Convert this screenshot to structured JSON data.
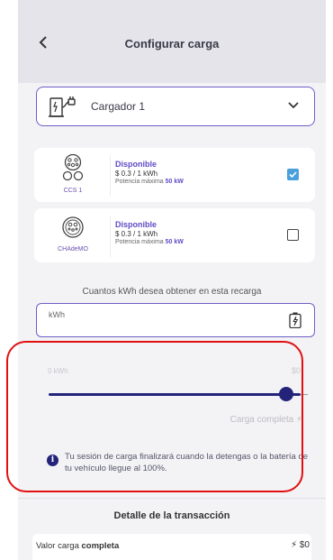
{
  "header": {
    "title": "Configurar carga"
  },
  "charger_select": {
    "selected": "Cargador 1"
  },
  "connectors": [
    {
      "name": "CCS 1",
      "status": "Disponible",
      "price": "$ 0.3 / 1 kWh",
      "power_label": "Potencia máxima",
      "power_value": "50 kW",
      "checked": true
    },
    {
      "name": "CHAdeMO",
      "status": "Disponible",
      "price": "$ 0.3 / 1 kWh",
      "power_label": "Potencia máxima",
      "power_value": "50 kW",
      "checked": false
    }
  ],
  "kwh_question": "Cuantos kWh desea obtener en esta recarga",
  "kwh_input": {
    "placeholder": "kWh"
  },
  "slider": {
    "min_label": "0 kWh",
    "max_label": "$0",
    "fill_fraction": 0.95,
    "full_label": "Carga completa ⚡︎"
  },
  "info_text": "Tu sesión de carga finalizará cuando la detengas o la batería de tu vehículo llegue al 100%.",
  "detail": {
    "title": "Detalle de la transacción",
    "row_label_prefix": "Valor carga ",
    "row_label_bold": "completa",
    "row_value": "⚡︎ $0"
  },
  "colors": {
    "accent": "#5f4bc7",
    "primary": "#23237a",
    "check": "#4aa0dc",
    "highlight": "#e01010"
  }
}
